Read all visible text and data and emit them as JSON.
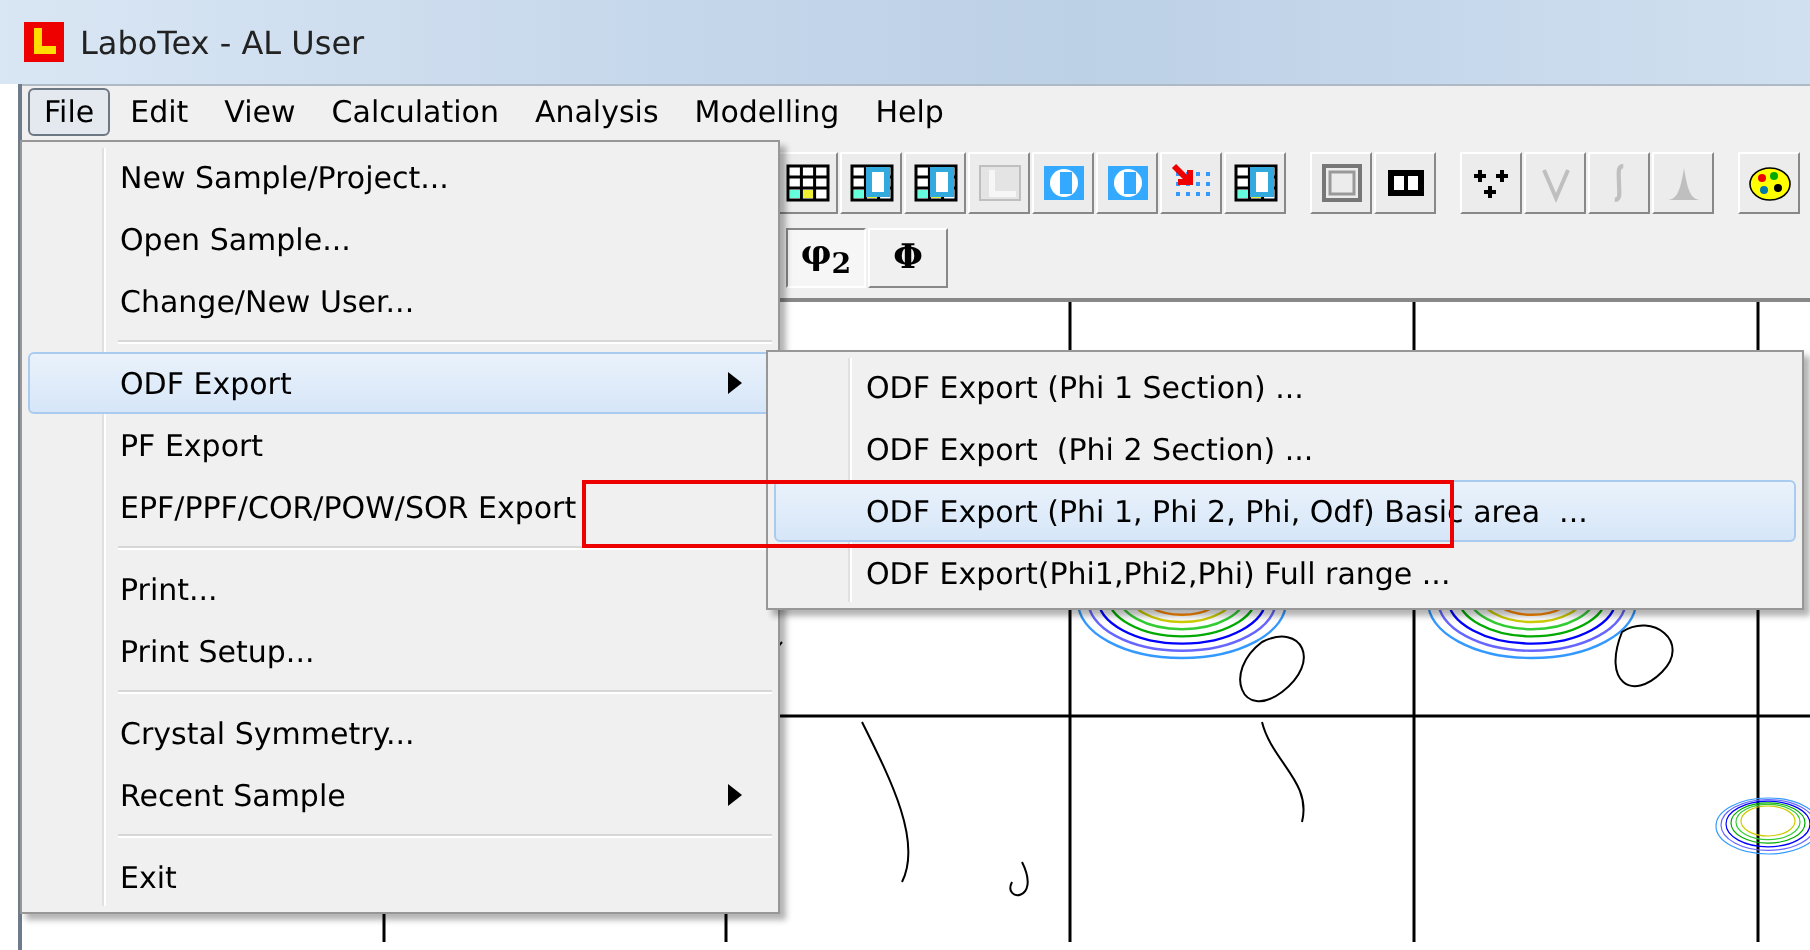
{
  "window": {
    "title": "LaboTex - AL User"
  },
  "menubar": [
    {
      "label": "File",
      "selected": true
    },
    {
      "label": "Edit",
      "selected": false
    },
    {
      "label": "View",
      "selected": false
    },
    {
      "label": "Calculation",
      "selected": false
    },
    {
      "label": "Analysis",
      "selected": false
    },
    {
      "label": "Modelling",
      "selected": false
    },
    {
      "label": "Help",
      "selected": false
    }
  ],
  "toolbar": [
    {
      "buttons": [
        {
          "kind": "grid",
          "disabled": false
        },
        {
          "kind": "grid-s",
          "disabled": false
        },
        {
          "kind": "grid-t",
          "disabled": false
        },
        {
          "kind": "grid-l",
          "disabled": true
        },
        {
          "kind": "cup-a",
          "disabled": false
        },
        {
          "kind": "cup-i",
          "disabled": false
        },
        {
          "kind": "scatter-arrow",
          "disabled": false
        },
        {
          "kind": "grid-m",
          "disabled": false
        }
      ]
    },
    {
      "buttons": [
        {
          "kind": "frame",
          "disabled": false
        },
        {
          "kind": "split",
          "disabled": false
        }
      ]
    },
    {
      "buttons": [
        {
          "kind": "crosses",
          "disabled": false
        },
        {
          "kind": "vee",
          "disabled": true
        },
        {
          "kind": "integral",
          "disabled": true
        },
        {
          "kind": "peak",
          "disabled": true
        }
      ]
    },
    {
      "buttons": [
        {
          "kind": "palette",
          "disabled": false
        }
      ]
    }
  ],
  "section_buttons": [
    {
      "label": "φ$_{2}$",
      "selected": true
    },
    {
      "label": "Φ",
      "selected": false
    }
  ],
  "file_menu": {
    "items": [
      {
        "kind": "item",
        "label": "New Sample/Project...",
        "has_submenu": false,
        "selected": false
      },
      {
        "kind": "item",
        "label": "Open Sample...",
        "has_submenu": false,
        "selected": false
      },
      {
        "kind": "item",
        "label": "Change/New User...",
        "has_submenu": false,
        "selected": false
      },
      {
        "kind": "separator"
      },
      {
        "kind": "item",
        "label": "ODF Export",
        "has_submenu": true,
        "selected": true
      },
      {
        "kind": "item",
        "label": "PF Export",
        "has_submenu": false,
        "selected": false
      },
      {
        "kind": "item",
        "label": "EPF/PPF/COR/POW/SOR Export",
        "has_submenu": false,
        "selected": false
      },
      {
        "kind": "separator"
      },
      {
        "kind": "item",
        "label": "Print...",
        "has_submenu": false,
        "selected": false
      },
      {
        "kind": "item",
        "label": "Print Setup...",
        "has_submenu": false,
        "selected": false
      },
      {
        "kind": "separator"
      },
      {
        "kind": "item",
        "label": "Crystal Symmetry...",
        "has_submenu": false,
        "selected": false
      },
      {
        "kind": "item",
        "label": "Recent Sample",
        "has_submenu": true,
        "selected": false
      },
      {
        "kind": "separator"
      },
      {
        "kind": "item",
        "label": "Exit",
        "has_submenu": false,
        "selected": false
      }
    ]
  },
  "submenu": {
    "items": [
      {
        "label": "ODF Export (Phi 1 Section) ...",
        "selected": false
      },
      {
        "label": "ODF Export  (Phi 2 Section) ...",
        "selected": false
      },
      {
        "label": "ODF Export (Phi 1, Phi 2, Phi, Odf) Basic area  ...",
        "selected": true
      },
      {
        "label": "ODF Export(Phi1,Phi2,Phi) Full range ...",
        "selected": false
      }
    ]
  },
  "annotation": {
    "kind": "highlight-frame"
  }
}
